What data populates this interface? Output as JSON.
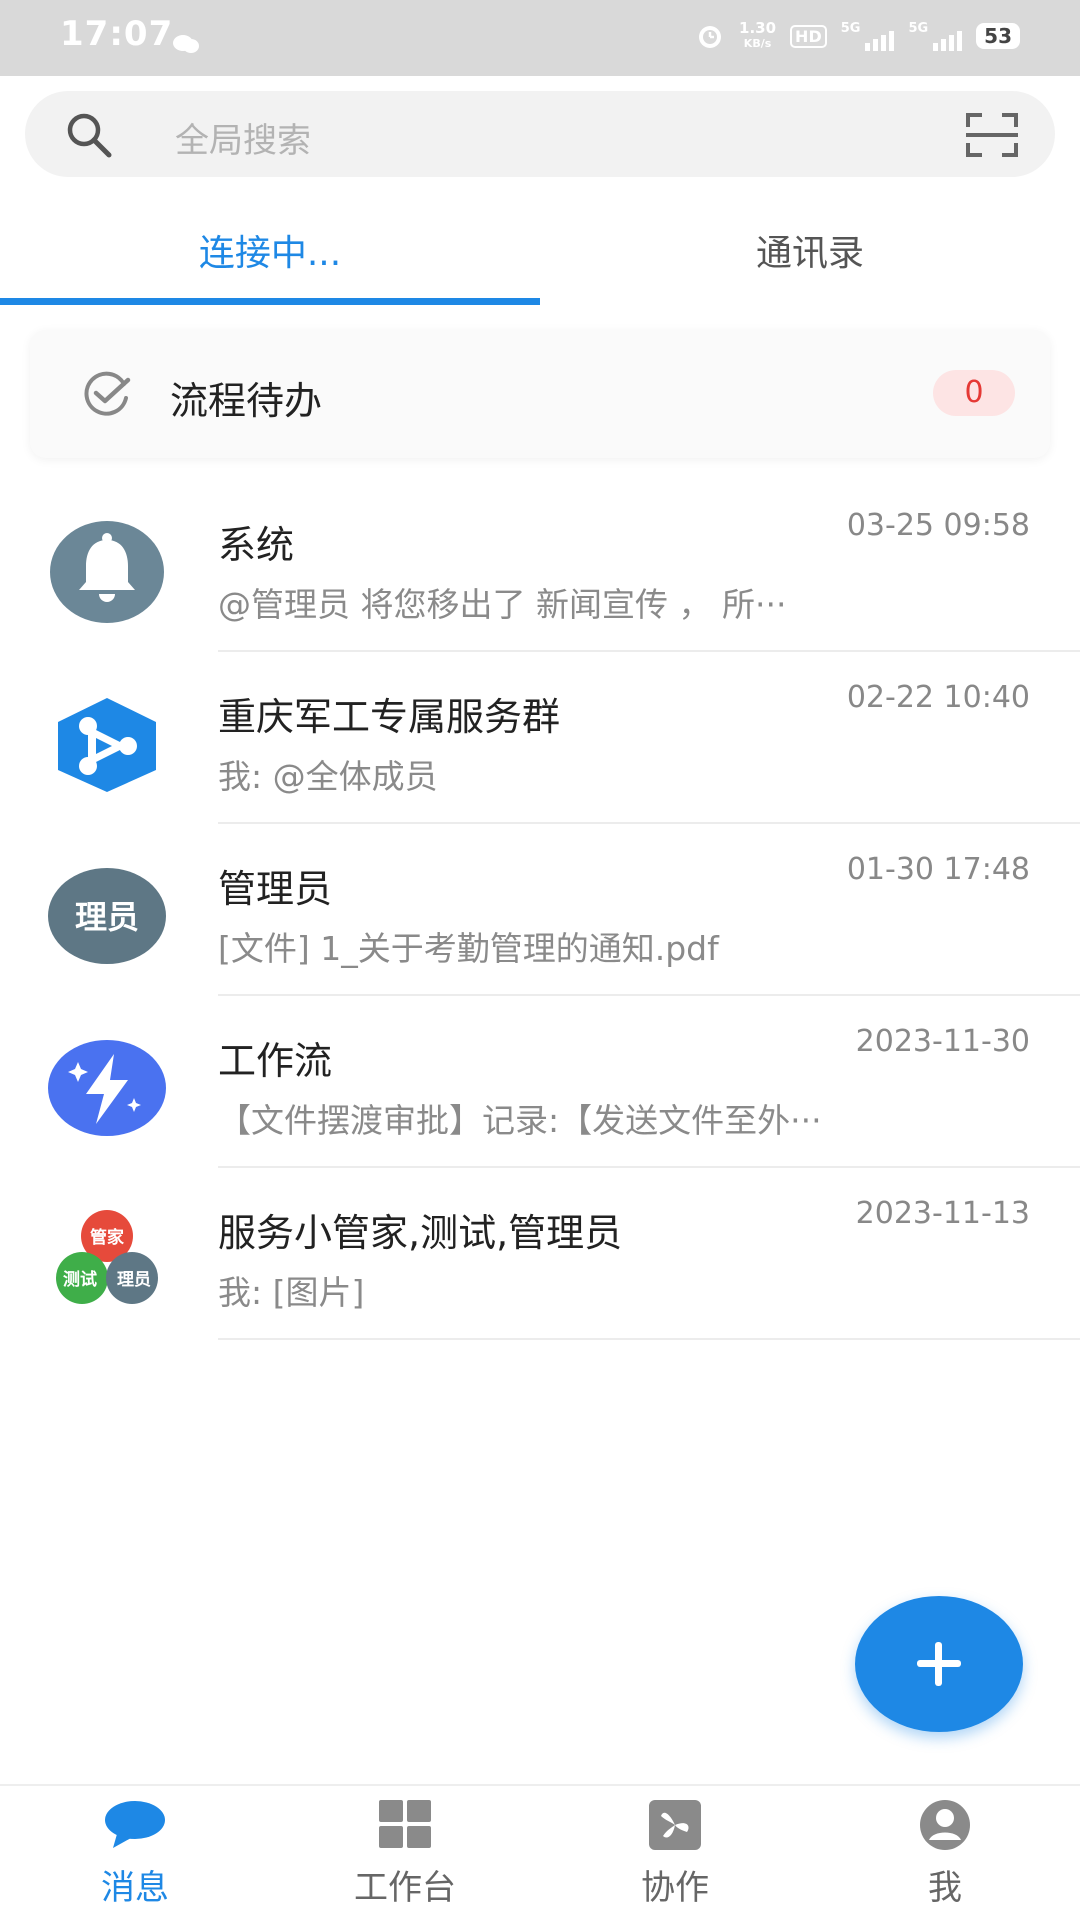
{
  "status_bar": {
    "time": "17:07",
    "net_speed_value": "1.30",
    "net_speed_unit": "KB/s",
    "hd_label": "HD",
    "network_1": "5G",
    "network_2": "5G",
    "battery": "53"
  },
  "search": {
    "placeholder": "全局搜索",
    "icon": "search-icon",
    "scan_icon": "scan-icon"
  },
  "tabs": [
    {
      "label": "连接中...",
      "active": true
    },
    {
      "label": "通讯录",
      "active": false
    }
  ],
  "todo": {
    "label": "流程待办",
    "count": "0"
  },
  "chats": [
    {
      "name": "系统",
      "time": "03-25 09:58",
      "preview": "@管理员 将您移出了 新闻宣传 ， 所···",
      "avatar": "bell-avatar"
    },
    {
      "name": "重庆军工专属服务群",
      "time": "02-22 10:40",
      "preview": "我: @全体成员",
      "avatar": "group-logo-avatar"
    },
    {
      "name": "管理员",
      "time": "01-30 17:48",
      "preview": "[文件] 1_关于考勤管理的通知.pdf",
      "avatar_text": "理员"
    },
    {
      "name": "工作流",
      "time": "2023-11-30",
      "preview": "【文件摆渡审批】记录:【发送文件至外···",
      "avatar": "workflow-avatar"
    },
    {
      "name": "服务小管家,测试,管理员",
      "time": "2023-11-13",
      "preview": "我: [图片]",
      "avatar_texts": [
        "管家",
        "测试",
        "理员"
      ]
    }
  ],
  "fab": {
    "icon": "plus-icon"
  },
  "bottom_nav": [
    {
      "label": "消息",
      "icon": "message-icon",
      "active": true
    },
    {
      "label": "工作台",
      "icon": "workbench-icon",
      "active": false
    },
    {
      "label": "协作",
      "icon": "collab-icon",
      "active": false
    },
    {
      "label": "我",
      "icon": "profile-icon",
      "active": false
    }
  ],
  "colors": {
    "accent": "#1e88e5",
    "badge_bg": "#fde4e4",
    "badge_text": "#e53935",
    "status_bar_bg": "#d9d9d9"
  }
}
